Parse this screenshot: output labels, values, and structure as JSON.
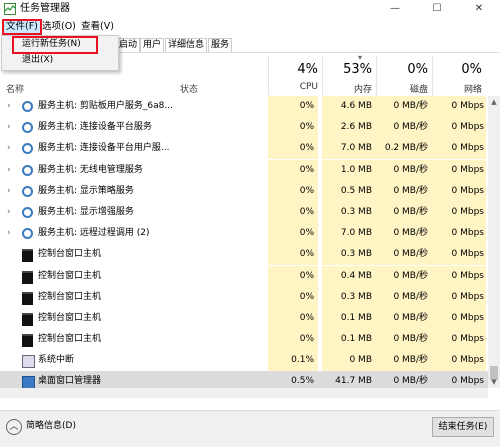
{
  "window": {
    "title": "任务管理器",
    "minimize": "—",
    "maximize": "☐",
    "close": "✕"
  },
  "menubar": {
    "file": "文件(F)",
    "options": "选项(O)",
    "view": "查看(V)"
  },
  "file_menu": {
    "items": [
      "运行新任务(N)",
      "退出(X)"
    ]
  },
  "tabs": [
    "启动",
    "用户",
    "详细信息",
    "服务"
  ],
  "header": {
    "name": "名称",
    "status": "状态",
    "cpu": {
      "pct": "4%",
      "label": "CPU"
    },
    "memory": {
      "pct": "53%",
      "label": "内存"
    },
    "disk": {
      "pct": "0%",
      "label": "磁盘"
    },
    "network": {
      "pct": "0%",
      "label": "网络"
    }
  },
  "rows": [
    {
      "name": "服务主机: 剪贴板用户服务_6a8...",
      "type": "service",
      "cpu": "0%",
      "mem": "4.6 MB",
      "disk": "0 MB/秒",
      "net": "0 Mbps"
    },
    {
      "name": "服务主机: 连接设备平台服务",
      "type": "service",
      "cpu": "0%",
      "mem": "2.6 MB",
      "disk": "0 MB/秒",
      "net": "0 Mbps"
    },
    {
      "name": "服务主机: 连接设备平台用户服...",
      "type": "service",
      "cpu": "0%",
      "mem": "7.0 MB",
      "disk": "0.2 MB/秒",
      "net": "0 Mbps"
    },
    {
      "name": "服务主机: 无线电管理服务",
      "type": "service",
      "cpu": "0%",
      "mem": "1.0 MB",
      "disk": "0 MB/秒",
      "net": "0 Mbps"
    },
    {
      "name": "服务主机: 显示策略服务",
      "type": "service",
      "cpu": "0%",
      "mem": "0.5 MB",
      "disk": "0 MB/秒",
      "net": "0 Mbps"
    },
    {
      "name": "服务主机: 显示增强服务",
      "type": "service",
      "cpu": "0%",
      "mem": "0.3 MB",
      "disk": "0 MB/秒",
      "net": "0 Mbps"
    },
    {
      "name": "服务主机: 远程过程调用 (2)",
      "type": "service",
      "cpu": "0%",
      "mem": "7.0 MB",
      "disk": "0 MB/秒",
      "net": "0 Mbps"
    },
    {
      "name": "控制台窗口主机",
      "type": "console",
      "cpu": "0%",
      "mem": "0.3 MB",
      "disk": "0 MB/秒",
      "net": "0 Mbps"
    },
    {
      "name": "控制台窗口主机",
      "type": "console",
      "cpu": "0%",
      "mem": "0.4 MB",
      "disk": "0 MB/秒",
      "net": "0 Mbps"
    },
    {
      "name": "控制台窗口主机",
      "type": "console",
      "cpu": "0%",
      "mem": "0.3 MB",
      "disk": "0 MB/秒",
      "net": "0 Mbps"
    },
    {
      "name": "控制台窗口主机",
      "type": "console",
      "cpu": "0%",
      "mem": "0.1 MB",
      "disk": "0 MB/秒",
      "net": "0 Mbps"
    },
    {
      "name": "控制台窗口主机",
      "type": "console",
      "cpu": "0%",
      "mem": "0.1 MB",
      "disk": "0 MB/秒",
      "net": "0 Mbps"
    },
    {
      "name": "系统中断",
      "type": "sysint",
      "cpu": "0.1%",
      "mem": "0 MB",
      "disk": "0 MB/秒",
      "net": "0 Mbps"
    },
    {
      "name": "桌面窗口管理器",
      "type": "dwm",
      "cpu": "0.5%",
      "mem": "41.7 MB",
      "disk": "0 MB/秒",
      "net": "0 Mbps"
    }
  ],
  "footer": {
    "fewer_details": "简略信息(D)",
    "end_task": "结束任务(E)"
  },
  "colors": {
    "heat_light": "#fff4c4",
    "heat_strong": "#ffe9a8",
    "highlight_red": "#e81123",
    "selected": "#dcdcdc"
  }
}
